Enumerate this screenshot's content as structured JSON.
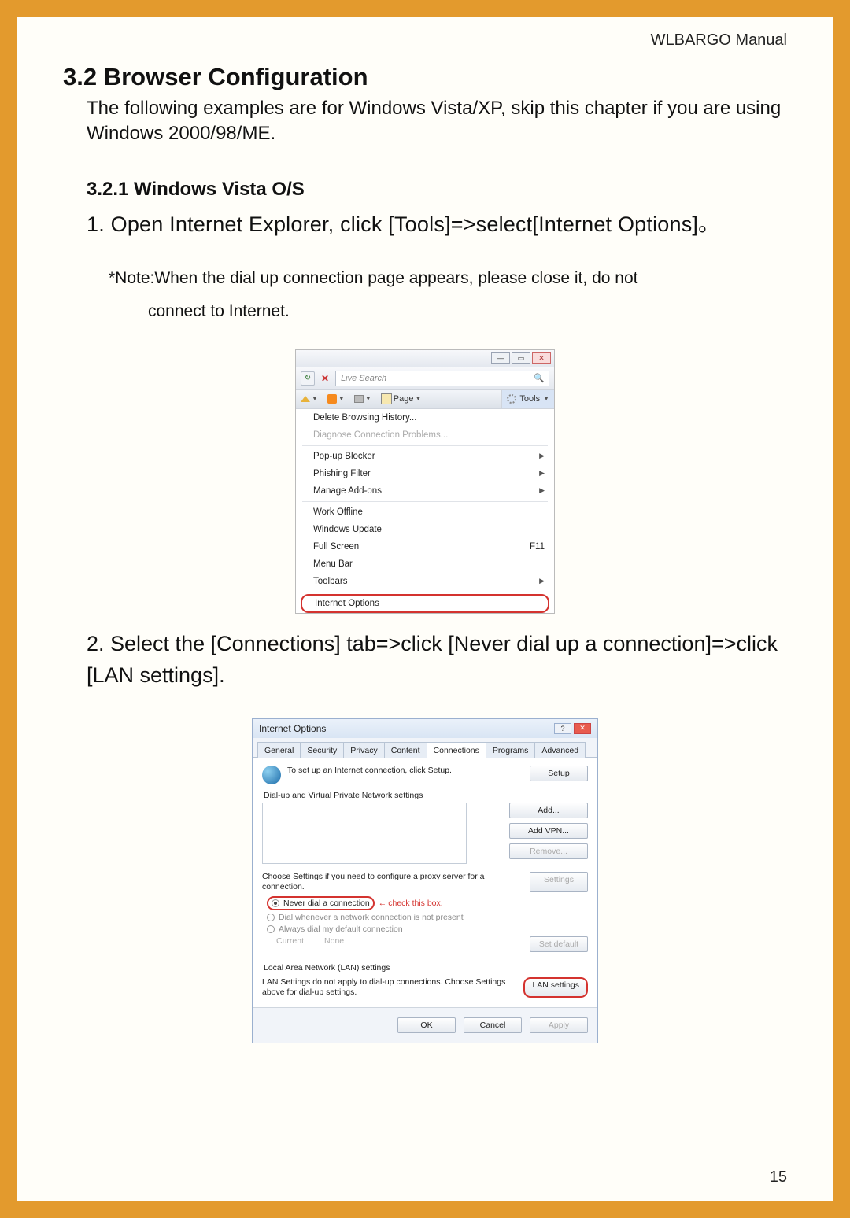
{
  "header": {
    "manual": "WLBARGO Manual"
  },
  "section": {
    "h2": "3.2 Browser Configuration",
    "intro": "The following examples are for Windows Vista/XP, skip this chapter if you are using Windows 2000/98/ME.",
    "h3": "3.2.1 Windows Vista O/S",
    "step1": "1. Open Internet Explorer, click [Tools]=>select[Internet Options]。",
    "note": "*Note:When the dial up connection page appears, please close it, do not",
    "note_cont": "connect to Internet.",
    "step2": "2. Select the [Connections] tab=>click [Never dial up a connection]=>click [LAN settings]."
  },
  "shot1": {
    "search_placeholder": "Live Search",
    "page_label": "Page",
    "tools_label": "Tools",
    "menu": {
      "m1": "Delete Browsing History...",
      "m2": "Diagnose Connection Problems...",
      "m3": "Pop-up Blocker",
      "m4": "Phishing Filter",
      "m5": "Manage Add-ons",
      "m6": "Work Offline",
      "m7": "Windows Update",
      "m8": "Full Screen",
      "m8_accel": "F11",
      "m9": "Menu Bar",
      "m10": "Toolbars",
      "m11": "Internet Options"
    }
  },
  "shot2": {
    "title": "Internet Options",
    "tabs": {
      "t1": "General",
      "t2": "Security",
      "t3": "Privacy",
      "t4": "Content",
      "t5": "Connections",
      "t6": "Programs",
      "t7": "Advanced"
    },
    "setup_text": "To set up an Internet connection, click Setup.",
    "btn_setup": "Setup",
    "fs1_legend": "Dial-up and Virtual Private Network settings",
    "btn_add": "Add...",
    "btn_addvpn": "Add VPN...",
    "btn_remove": "Remove...",
    "proxy_text": "Choose Settings if you need to configure a proxy server for a connection.",
    "btn_settings": "Settings",
    "r1": "Never dial a connection",
    "check_note": "check this box.",
    "r2": "Dial whenever a network connection is not present",
    "r3": "Always dial my default connection",
    "current_label": "Current",
    "current_value": "None",
    "btn_setdef": "Set default",
    "fs2_legend": "Local Area Network (LAN) settings",
    "lan_text": "LAN Settings do not apply to dial-up connections. Choose Settings above for dial-up settings.",
    "btn_lan": "LAN settings",
    "btn_ok": "OK",
    "btn_cancel": "Cancel",
    "btn_apply": "Apply"
  },
  "page_number": "15"
}
